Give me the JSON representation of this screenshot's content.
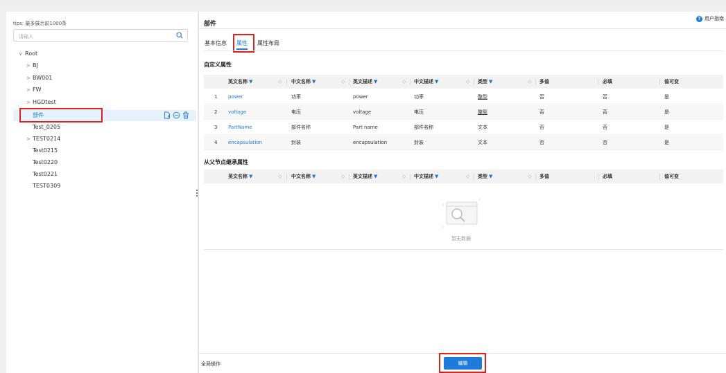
{
  "left": {
    "tips": "tips: 最多展示前1000条",
    "search_placeholder": "请输入",
    "tree": [
      {
        "label": "Root",
        "arrow": "∨"
      },
      {
        "label": "BJ",
        "arrow": ">"
      },
      {
        "label": "BW001",
        "arrow": ">"
      },
      {
        "label": "FW",
        "arrow": ">"
      },
      {
        "label": "HGDtest",
        "arrow": ">"
      },
      {
        "label": "部件",
        "arrow": ""
      },
      {
        "label": "Test_0205",
        "arrow": ""
      },
      {
        "label": "TEST0214",
        "arrow": ">"
      },
      {
        "label": "Test0215",
        "arrow": ""
      },
      {
        "label": "Test0220",
        "arrow": ""
      },
      {
        "label": "Test0221",
        "arrow": ""
      },
      {
        "label": "TEST0309",
        "arrow": ""
      }
    ]
  },
  "header": {
    "title": "部件",
    "help": "用户指南"
  },
  "tabs": [
    "基本信息",
    "属性",
    "属性布局"
  ],
  "active_tab": "属性",
  "custom_section": "自定义属性",
  "inherit_section": "从父节点继承属性",
  "columns": {
    "en_name": "英文名称",
    "cn_name": "中文名称",
    "en_desc": "英文描述",
    "cn_desc": "中文描述",
    "type": "类型",
    "multi": "多值",
    "required": "必填",
    "mutable": "值可变"
  },
  "filter_icon": "▼",
  "rows": [
    {
      "no": "1",
      "en_name": "power",
      "cn_name": "功率",
      "en_desc": "power",
      "cn_desc": "功率",
      "type": "整型",
      "multi": "否",
      "required": "否",
      "mutable": "是"
    },
    {
      "no": "2",
      "en_name": "voltage",
      "cn_name": "电压",
      "en_desc": "voltage",
      "cn_desc": "电压",
      "type": "整型",
      "multi": "否",
      "required": "否",
      "mutable": "是"
    },
    {
      "no": "3",
      "en_name": "PartName",
      "cn_name": "部件名称",
      "en_desc": "Part name",
      "cn_desc": "部件名称",
      "type": "文本",
      "multi": "否",
      "required": "否",
      "mutable": "是"
    },
    {
      "no": "4",
      "en_name": "encapsulation",
      "cn_name": "封装",
      "en_desc": "encapsulation",
      "cn_desc": "封装",
      "type": "文本",
      "multi": "否",
      "required": "否",
      "mutable": "是"
    }
  ],
  "empty_text": "暂无数据",
  "footer": {
    "global_ops": "全局操作",
    "edit": "编辑"
  },
  "colors": {
    "accent": "#1f7bdb",
    "highlight_box": "#e0201c",
    "selected_bg": "#e6f1fc"
  }
}
